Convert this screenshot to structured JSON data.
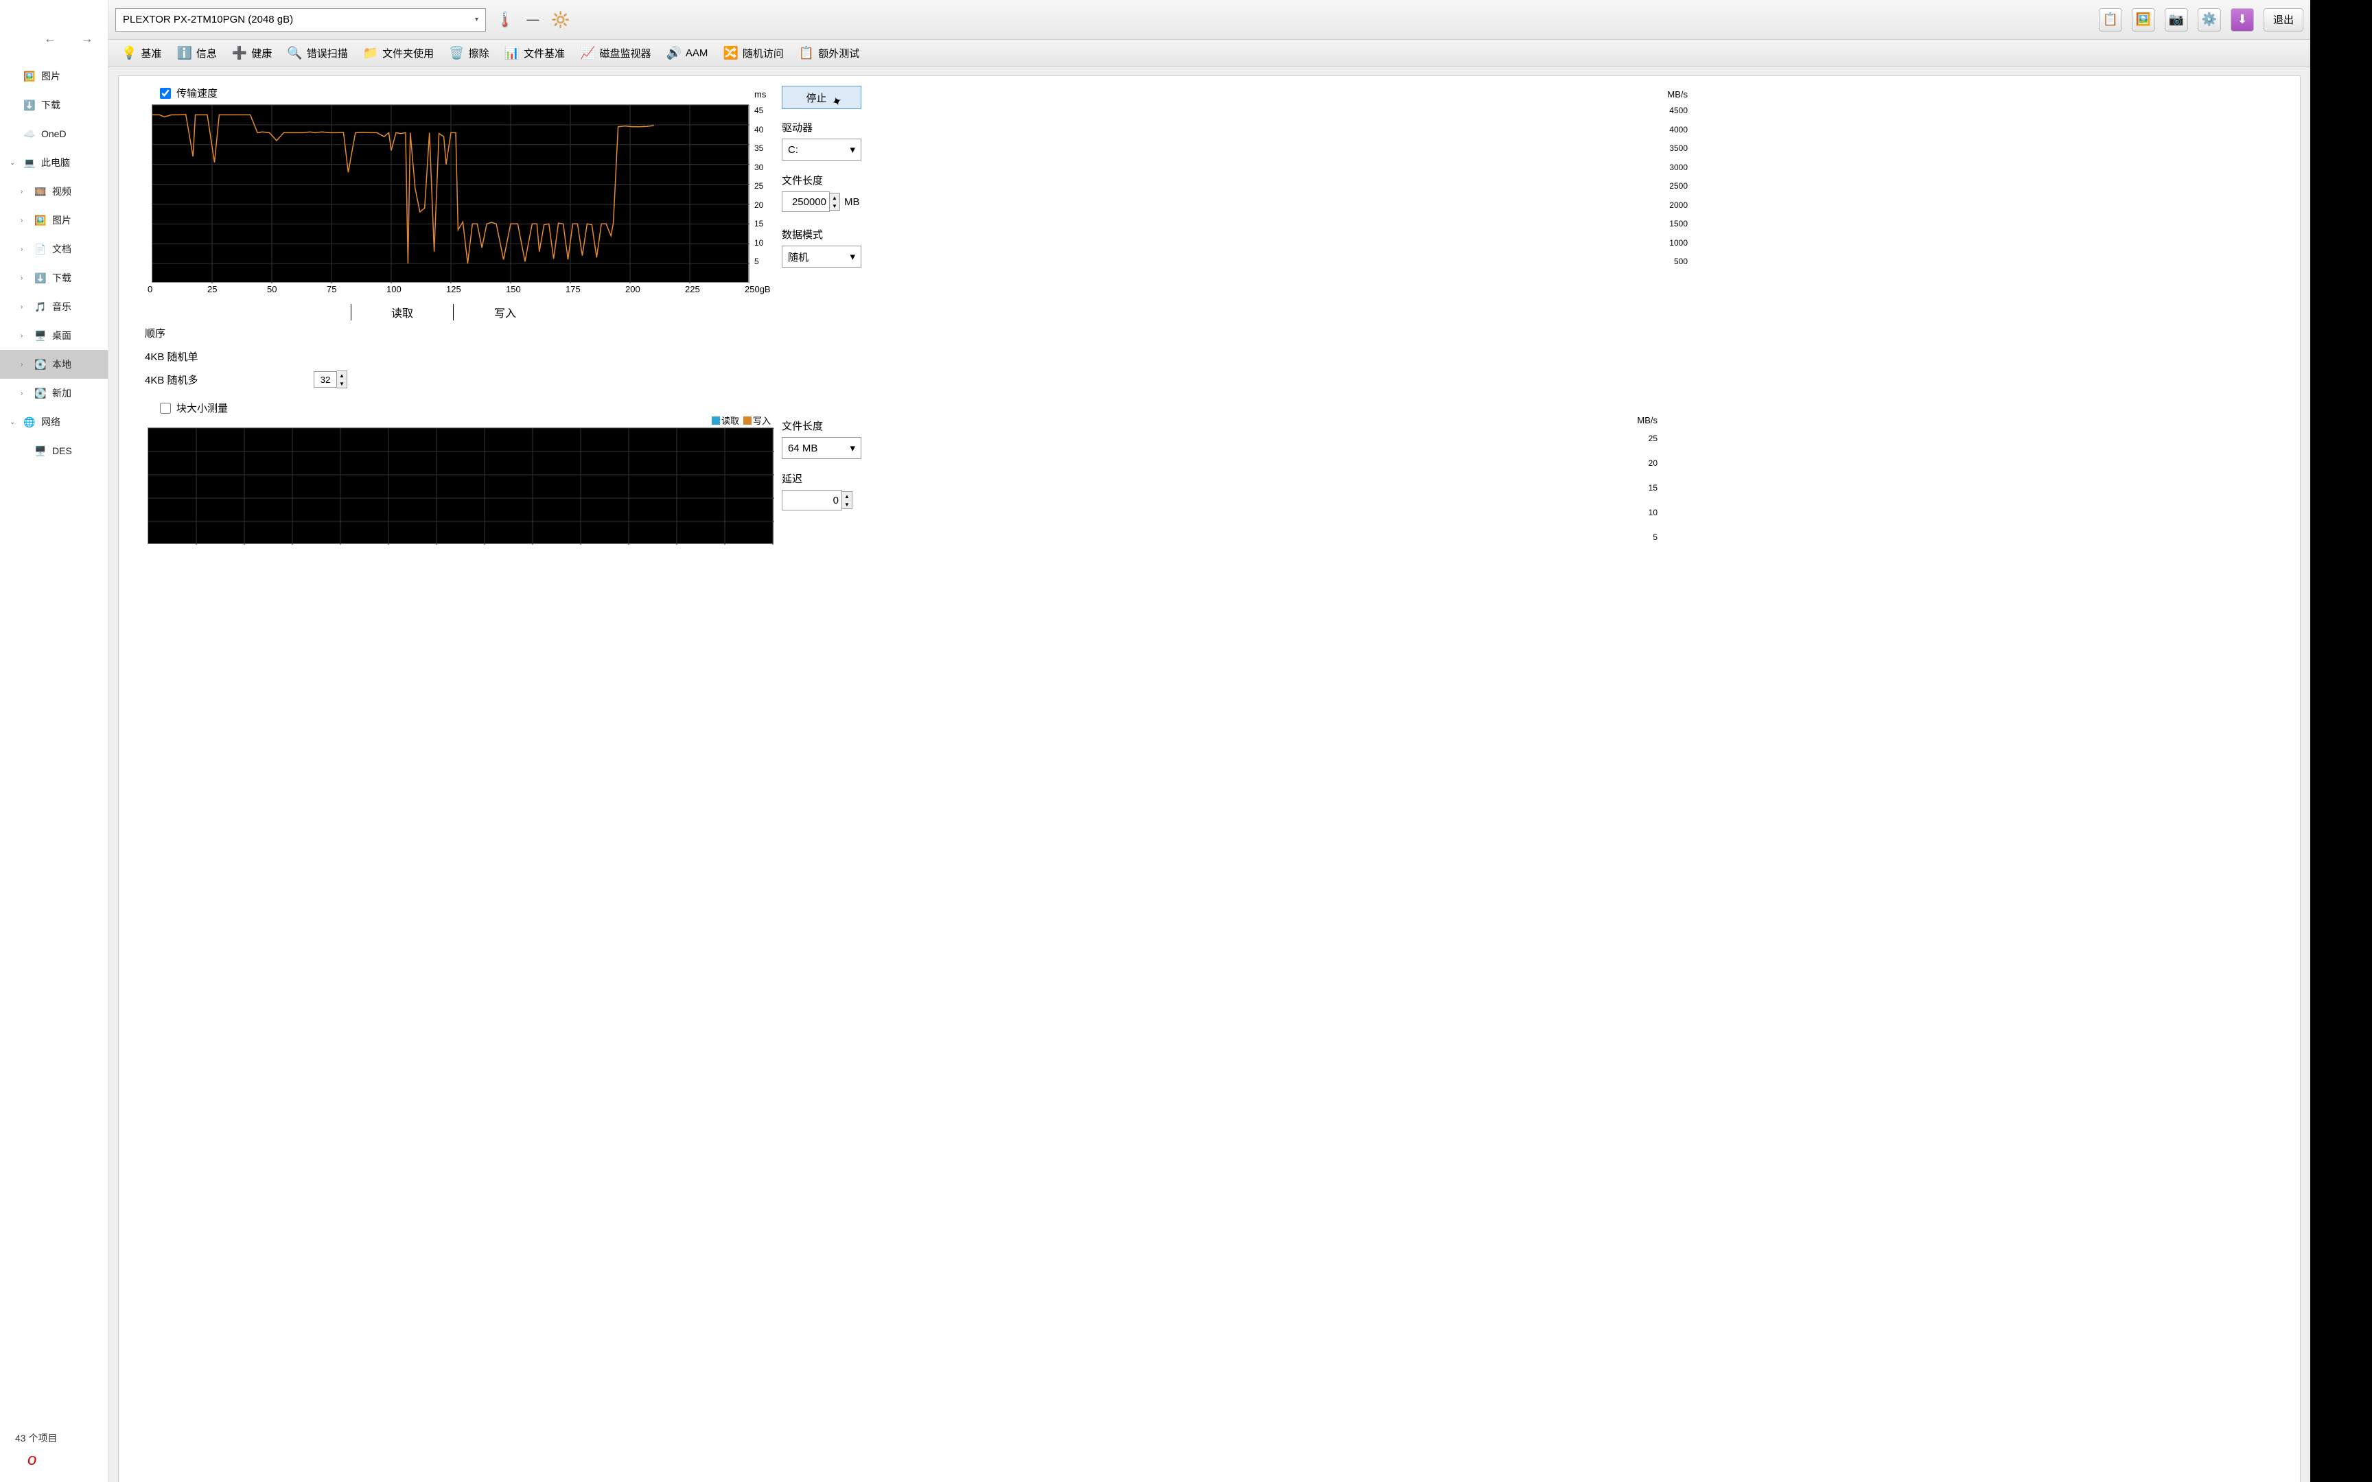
{
  "explorer": {
    "back_icon": "←",
    "fwd_icon": "→",
    "items": [
      {
        "icon": "🖼️",
        "label": "图片",
        "caret": ""
      },
      {
        "icon": "⬇️",
        "label": "下载",
        "caret": ""
      },
      {
        "icon": "☁️",
        "label": "OneD",
        "caret": ""
      },
      {
        "icon": "💻",
        "label": "此电脑",
        "caret": "⌄"
      },
      {
        "icon": "🎞️",
        "label": "视频",
        "caret": "›",
        "indent": true
      },
      {
        "icon": "🖼️",
        "label": "图片",
        "caret": "›",
        "indent": true
      },
      {
        "icon": "📄",
        "label": "文档",
        "caret": "›",
        "indent": true
      },
      {
        "icon": "⬇️",
        "label": "下载",
        "caret": "›",
        "indent": true
      },
      {
        "icon": "🎵",
        "label": "音乐",
        "caret": "›",
        "indent": true
      },
      {
        "icon": "🖥️",
        "label": "桌面",
        "caret": "›",
        "indent": true
      },
      {
        "icon": "💽",
        "label": "本地",
        "caret": "›",
        "indent": true,
        "sel": true
      },
      {
        "icon": "💽",
        "label": "新加",
        "caret": "›",
        "indent": true
      },
      {
        "icon": "🌐",
        "label": "网络",
        "caret": "⌄"
      },
      {
        "icon": "🖥️",
        "label": "DES",
        "caret": "",
        "indent": true
      }
    ],
    "footer": "43 个项目",
    "red": "o"
  },
  "topbar": {
    "drive": "PLEXTOR PX-2TM10PGN (2048 gB)",
    "exit": "退出"
  },
  "tabs": [
    {
      "icon": "💡",
      "label": "基准"
    },
    {
      "icon": "ℹ️",
      "label": "信息"
    },
    {
      "icon": "➕",
      "label": "健康"
    },
    {
      "icon": "🔍",
      "label": "错误扫描"
    },
    {
      "icon": "📁",
      "label": "文件夹使用"
    },
    {
      "icon": "🗑️",
      "label": "擦除"
    },
    {
      "icon": "📊",
      "label": "文件基准"
    },
    {
      "icon": "📈",
      "label": "磁盘监视器"
    },
    {
      "icon": "🔊",
      "label": "AAM"
    },
    {
      "icon": "🔀",
      "label": "随机访问"
    },
    {
      "icon": "📋",
      "label": "额外测试"
    }
  ],
  "panel": {
    "transfer_speed_check": "传输速度",
    "block_size_check": "块大小测量",
    "stop": "停止",
    "drive_lbl": "驱动器",
    "drive_val": "C:",
    "filelen_lbl": "文件长度",
    "filelen_val": "250000",
    "filelen_unit": "MB",
    "datamode_lbl": "数据模式",
    "datamode_val": "随机",
    "filelen2_lbl": "文件长度",
    "filelen2_val": "64 MB",
    "delay_lbl": "延迟",
    "delay_val": "0"
  },
  "mini_table": {
    "hdr_read": "读取",
    "hdr_write": "写入",
    "rows": [
      {
        "label": "顺序"
      },
      {
        "label": "4KB 随机单"
      },
      {
        "label": "4KB 随机多",
        "spin": "32"
      }
    ]
  },
  "chart2_legend": {
    "read": "读取",
    "write": "写入"
  },
  "chart_data": [
    {
      "type": "line",
      "title": "",
      "x_unit": "gB",
      "xlabel": "",
      "ylabel_left": "MB/s",
      "ylabel_right": "ms",
      "xlim": [
        0,
        250
      ],
      "ylim_left": [
        0,
        4500
      ],
      "ylim_right": [
        0,
        45
      ],
      "x_ticks": [
        0,
        25,
        50,
        75,
        100,
        125,
        150,
        175,
        200,
        225,
        250
      ],
      "y_ticks_left": [
        500,
        1000,
        1500,
        2000,
        2500,
        3000,
        3500,
        4000,
        4500
      ],
      "y_ticks_right": [
        5,
        10,
        15,
        20,
        25,
        30,
        35,
        40,
        45
      ],
      "series": [
        {
          "name": "传输速度",
          "color": "#e58a2d",
          "x": [
            0,
            3,
            5,
            8,
            11,
            14,
            17,
            18,
            20,
            23,
            26,
            28,
            30,
            33,
            36,
            38,
            41,
            44,
            46,
            49,
            52,
            55,
            57,
            60,
            63,
            66,
            68,
            71,
            74,
            77,
            80,
            82,
            85,
            88,
            91,
            94,
            97,
            99,
            100,
            102,
            104,
            106,
            107,
            108,
            110,
            112,
            114,
            116,
            118,
            120,
            122,
            123,
            125,
            127,
            128,
            130,
            132,
            134,
            136,
            138,
            140,
            142,
            144,
            147,
            150,
            153,
            156,
            159,
            161,
            162,
            164,
            166,
            168,
            170,
            172,
            174,
            176,
            178,
            180,
            182,
            184,
            186,
            188,
            190,
            192,
            193,
            195,
            198,
            201,
            204,
            207,
            210
          ],
          "values": [
            4250,
            4250,
            4200,
            4250,
            4250,
            4260,
            3200,
            4250,
            4250,
            4250,
            3050,
            4250,
            4250,
            4250,
            4250,
            4250,
            4250,
            3800,
            3820,
            3800,
            3600,
            3800,
            3800,
            3800,
            3800,
            3820,
            3800,
            3820,
            3800,
            3800,
            3810,
            2800,
            3800,
            3810,
            3800,
            3800,
            3700,
            3800,
            3350,
            3800,
            3780,
            3800,
            500,
            3800,
            2400,
            1800,
            1900,
            3800,
            800,
            3780,
            3700,
            3000,
            3800,
            3800,
            1350,
            1550,
            500,
            1500,
            1500,
            900,
            1500,
            1540,
            1500,
            600,
            1500,
            1500,
            550,
            1500,
            1500,
            800,
            1480,
            1500,
            620,
            1520,
            1500,
            600,
            1500,
            1500,
            700,
            1500,
            1480,
            650,
            1500,
            1500,
            1200,
            1520,
            3950,
            3970,
            3950,
            3950,
            3960,
            3980
          ]
        }
      ]
    },
    {
      "type": "bar",
      "title": "",
      "xlabel": "",
      "ylabel": "MB/s",
      "ylim": [
        0,
        25
      ],
      "y_ticks": [
        5,
        10,
        15,
        20,
        25
      ],
      "series": [
        {
          "name": "读取",
          "color": "#2aa3d8",
          "values": []
        },
        {
          "name": "写入",
          "color": "#d8862a",
          "values": []
        }
      ]
    }
  ]
}
